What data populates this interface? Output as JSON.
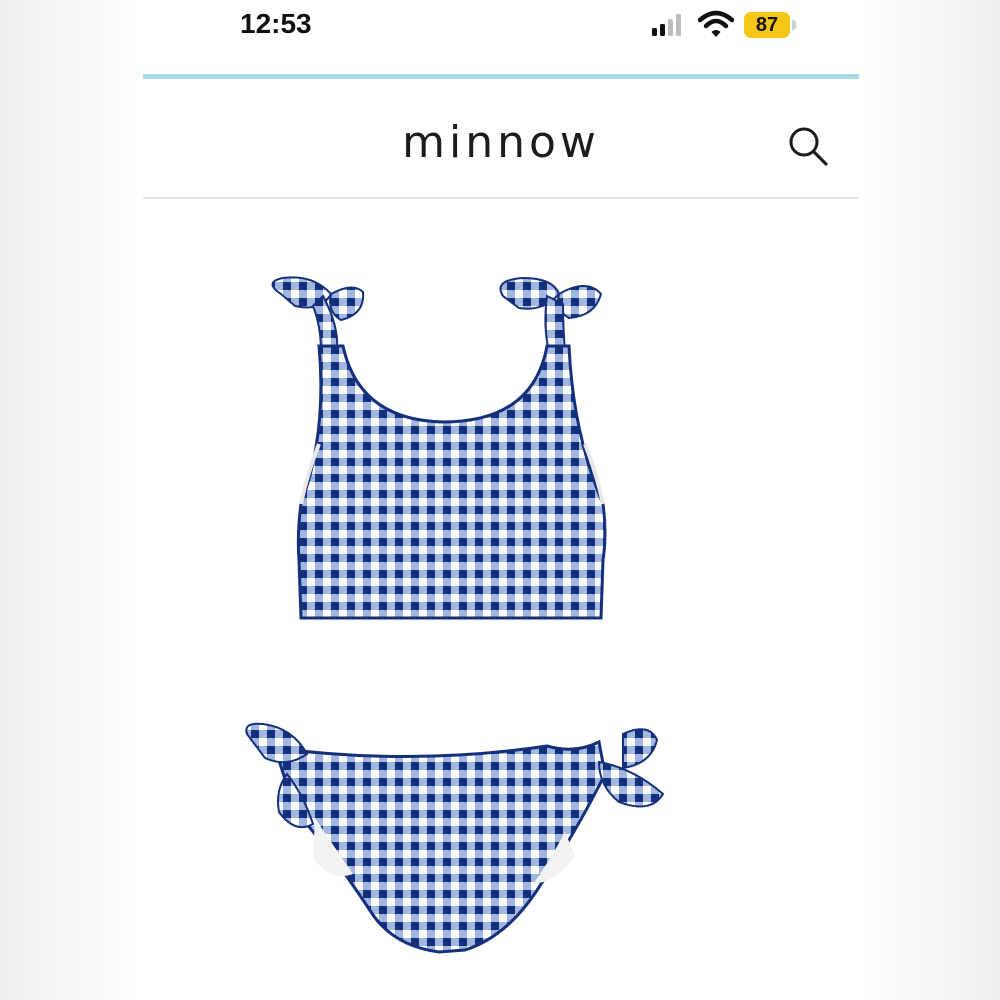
{
  "status_bar": {
    "time": "12:53",
    "battery_level": "87",
    "battery_color": "#f5c518",
    "icons": [
      "signal-icon",
      "wifi-icon",
      "battery-icon"
    ]
  },
  "header": {
    "brand": "minnow",
    "accent_color": "#a6dde8",
    "search_icon": "search-icon"
  },
  "product": {
    "image_description_icon": "gingham-bikini-image",
    "primary_color": "#1e3f8a"
  }
}
